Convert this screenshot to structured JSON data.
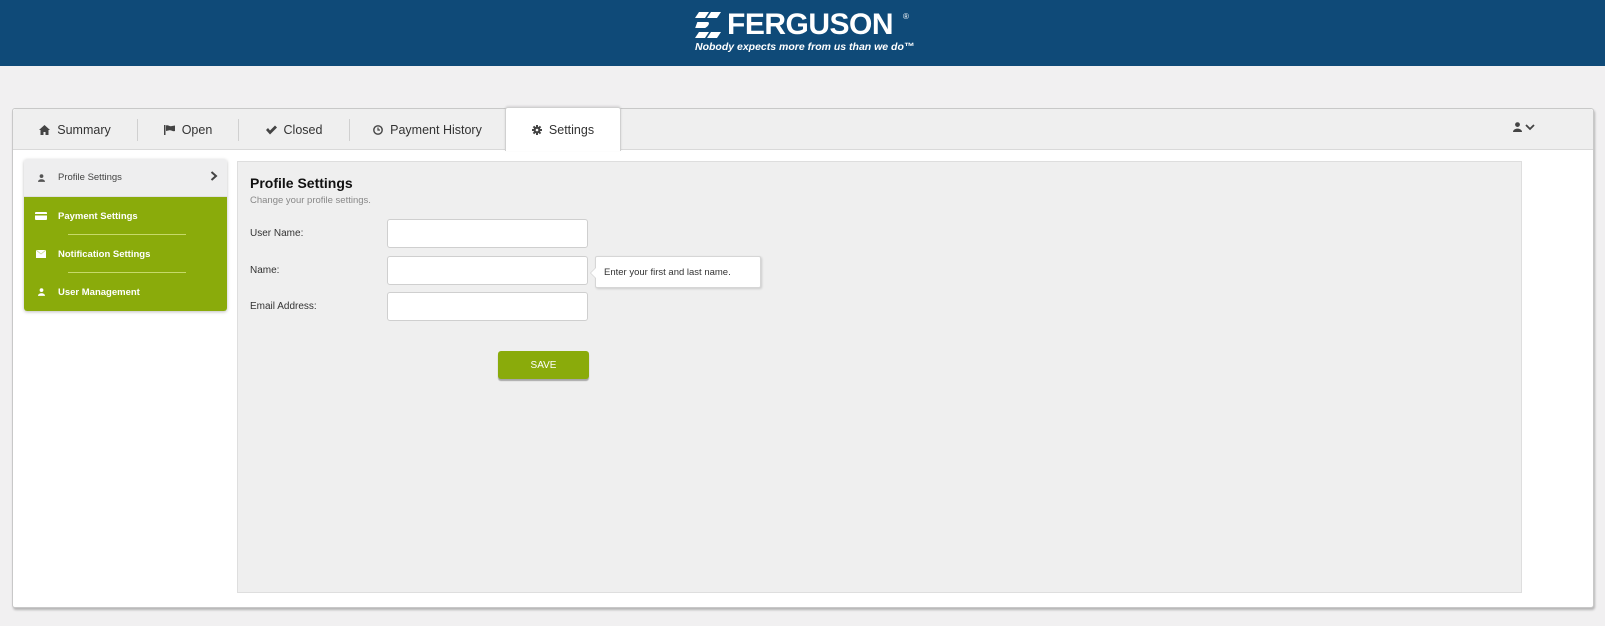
{
  "header": {
    "brand": "FERGUSON",
    "registered_mark": "®",
    "tagline": "Nobody expects more from us than we do™",
    "background_color": "#0f4a78"
  },
  "tabs": [
    {
      "label": "Summary",
      "icon": "home-icon",
      "active": false
    },
    {
      "label": "Open",
      "icon": "flag-icon",
      "active": false
    },
    {
      "label": "Closed",
      "icon": "check-icon",
      "active": false
    },
    {
      "label": "Payment History",
      "icon": "clock-icon",
      "active": false
    },
    {
      "label": "Settings",
      "icon": "gear-icon",
      "active": true
    }
  ],
  "user_menu": {
    "icon": "user-icon",
    "caret": "chevron-down-icon"
  },
  "sidebar": {
    "items": [
      {
        "label": "Profile Settings",
        "icon": "user-icon",
        "current": true
      },
      {
        "label": "Payment Settings",
        "icon": "credit-card-icon",
        "current": false
      },
      {
        "label": "Notification Settings",
        "icon": "envelope-icon",
        "current": false
      },
      {
        "label": "User Management",
        "icon": "user-icon",
        "current": false
      }
    ],
    "accent_color": "#8aab0b"
  },
  "profile": {
    "title": "Profile Settings",
    "subtitle": "Change your profile settings.",
    "fields": [
      {
        "label": "User Name:",
        "value": "",
        "placeholder": ""
      },
      {
        "label": "Name:",
        "value": "",
        "placeholder": ""
      },
      {
        "label": "Email Address:",
        "value": "",
        "placeholder": ""
      }
    ],
    "tooltip": "Enter your first and last name.",
    "save_label": "SAVE"
  }
}
